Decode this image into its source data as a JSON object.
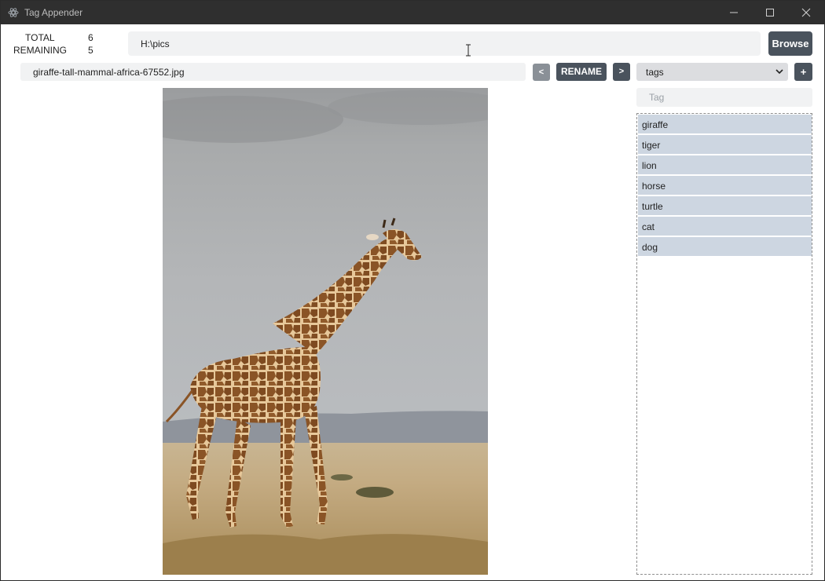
{
  "window": {
    "title": "Tag Appender"
  },
  "counts": {
    "total_label": "TOTAL",
    "total_value": "6",
    "remaining_label": "REMAINING",
    "remaining_value": "5"
  },
  "path": {
    "value": "H:\\pics",
    "browse_label": "Browse"
  },
  "file": {
    "name": "giraffe-tall-mammal-africa-67552.jpg",
    "prev_label": "<",
    "rename_label": "RENAME",
    "next_label": ">"
  },
  "tags": {
    "select_value": "tags",
    "add_label": "+",
    "input_placeholder": "Tag",
    "items": [
      "giraffe",
      "tiger",
      "lion",
      "horse",
      "turtle",
      "cat",
      "dog"
    ]
  },
  "colors": {
    "titlebar": "#2f2f2f",
    "button_dark": "#4a535d",
    "tag_item": "#cdd6e1",
    "input_bg": "#f1f2f3"
  },
  "icons": [
    "app-icon",
    "minimize-icon",
    "maximize-icon",
    "close-icon",
    "chevron-down-icon",
    "text-cursor-icon"
  ]
}
